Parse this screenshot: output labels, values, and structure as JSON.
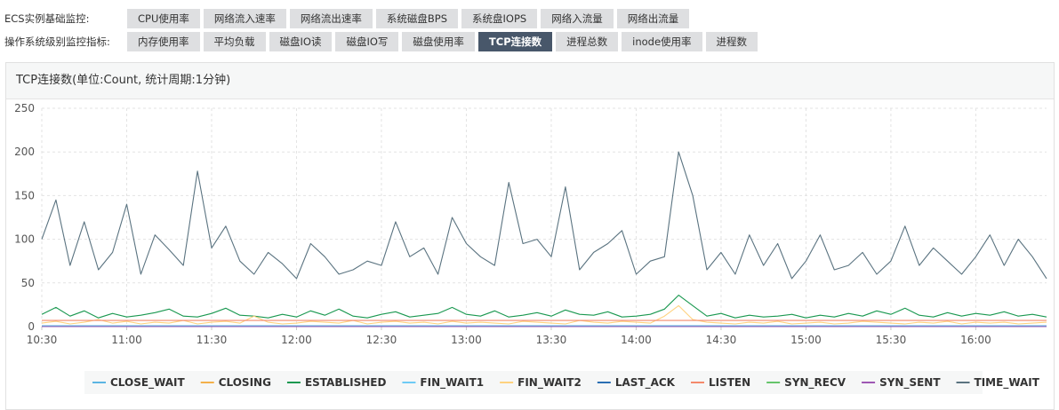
{
  "nav": {
    "ecs_label": "ECS实例基础监控:",
    "ecs_tabs": [
      "CPU使用率",
      "网络流入速率",
      "网络流出速率",
      "系统磁盘BPS",
      "系统盘IOPS",
      "网络入流量",
      "网络出流量"
    ],
    "os_label": "操作系统级别监控指标:",
    "os_tabs": [
      "内存使用率",
      "平均负载",
      "磁盘IO读",
      "磁盘IO写",
      "磁盘使用率",
      "TCP连接数",
      "进程总数",
      "inode使用率",
      "进程数"
    ],
    "active_tab": "TCP连接数"
  },
  "panel": {
    "title": "TCP连接数(单位:Count, 统计周期:1分钟)"
  },
  "chart_data": {
    "type": "line",
    "title": "TCP连接数(单位:Count, 统计周期:1分钟)",
    "x_ticks": [
      "10:30",
      "11:00",
      "11:30",
      "12:00",
      "12:30",
      "13:00",
      "13:30",
      "14:00",
      "14:30",
      "15:00",
      "15:30",
      "16:00"
    ],
    "x_range": [
      "10:30",
      "16:25"
    ],
    "y_ticks": [
      0,
      50,
      100,
      150,
      200,
      250
    ],
    "ylim": [
      0,
      250
    ],
    "grid": true,
    "legend_position": "bottom",
    "sample_interval": "5 minutes",
    "series": [
      {
        "name": "CLOSE_WAIT",
        "color": "#5bb5e3",
        "values": [
          1,
          1,
          1,
          1,
          1,
          1,
          1,
          1,
          1,
          1,
          1,
          1,
          1,
          1,
          1,
          1,
          1,
          1,
          1,
          1,
          1,
          1,
          1,
          1,
          1,
          1,
          1,
          1,
          1,
          1,
          1,
          1,
          1,
          1,
          1,
          1,
          1,
          1,
          1,
          1,
          1,
          1,
          1,
          1,
          1,
          1,
          1,
          1,
          1,
          1,
          1,
          1,
          1,
          1,
          1,
          1,
          1,
          1,
          1,
          1,
          1,
          1,
          1,
          1,
          1,
          1,
          1,
          1,
          1,
          1,
          1,
          1
        ]
      },
      {
        "name": "CLOSING",
        "color": "#f3b04a",
        "values": [
          0,
          0,
          0,
          0,
          0,
          0,
          0,
          0,
          0,
          0,
          0,
          0,
          0,
          0,
          0,
          0,
          0,
          0,
          0,
          0,
          0,
          0,
          0,
          0,
          0,
          0,
          0,
          0,
          0,
          0,
          0,
          0,
          0,
          0,
          0,
          0,
          0,
          0,
          0,
          0,
          0,
          0,
          0,
          0,
          0,
          0,
          0,
          0,
          0,
          0,
          0,
          0,
          0,
          0,
          0,
          0,
          0,
          0,
          0,
          0,
          0,
          0,
          0,
          0,
          0,
          0,
          0,
          0,
          0,
          0,
          0,
          0
        ]
      },
      {
        "name": "ESTABLISHED",
        "color": "#1a9850",
        "values": [
          14,
          22,
          12,
          18,
          10,
          15,
          11,
          13,
          16,
          20,
          12,
          11,
          15,
          21,
          13,
          12,
          10,
          14,
          11,
          18,
          13,
          20,
          12,
          10,
          14,
          17,
          11,
          13,
          15,
          22,
          14,
          12,
          18,
          11,
          13,
          16,
          12,
          19,
          14,
          13,
          17,
          11,
          12,
          14,
          20,
          36,
          24,
          12,
          15,
          10,
          13,
          11,
          12,
          14,
          10,
          13,
          11,
          15,
          12,
          18,
          14,
          21,
          13,
          11,
          16,
          12,
          15,
          13,
          17,
          12,
          14,
          11
        ]
      },
      {
        "name": "FIN_WAIT1",
        "color": "#6ecbf5",
        "values": [
          0,
          0,
          0,
          0,
          0,
          0,
          0,
          0,
          0,
          0,
          0,
          0,
          0,
          0,
          0,
          0,
          0,
          0,
          0,
          0,
          0,
          0,
          0,
          0,
          0,
          0,
          0,
          0,
          0,
          0,
          0,
          0,
          0,
          0,
          0,
          0,
          0,
          0,
          0,
          0,
          0,
          0,
          0,
          0,
          0,
          0,
          0,
          0,
          0,
          0,
          0,
          0,
          0,
          0,
          0,
          0,
          0,
          0,
          0,
          0,
          0,
          0,
          0,
          0,
          0,
          0,
          0,
          0,
          0,
          0,
          0,
          0
        ]
      },
      {
        "name": "FIN_WAIT2",
        "color": "#ffd27f",
        "values": [
          4,
          6,
          3,
          5,
          8,
          4,
          6,
          3,
          5,
          4,
          7,
          3,
          5,
          6,
          4,
          12,
          5,
          3,
          4,
          6,
          5,
          4,
          7,
          3,
          5,
          6,
          4,
          5,
          3,
          6,
          4,
          5,
          4,
          3,
          6,
          5,
          4,
          3,
          7,
          5,
          4,
          6,
          5,
          4,
          12,
          24,
          8,
          5,
          4,
          3,
          5,
          4,
          6,
          3,
          4,
          5,
          3,
          4,
          6,
          5,
          4,
          3,
          5,
          4,
          6,
          3,
          5,
          4,
          5,
          3,
          4,
          5
        ]
      },
      {
        "name": "LAST_ACK",
        "color": "#2b6fb3",
        "values": [
          0,
          0,
          0,
          0,
          0,
          0,
          0,
          0,
          0,
          0,
          0,
          0,
          0,
          0,
          0,
          0,
          0,
          0,
          0,
          0,
          0,
          0,
          0,
          0,
          0,
          0,
          0,
          0,
          0,
          0,
          0,
          0,
          0,
          0,
          0,
          0,
          0,
          0,
          0,
          0,
          0,
          0,
          0,
          0,
          0,
          0,
          0,
          0,
          0,
          0,
          0,
          0,
          0,
          0,
          0,
          0,
          0,
          0,
          0,
          0,
          0,
          0,
          0,
          0,
          0,
          0,
          0,
          0,
          0,
          0,
          0,
          0
        ]
      },
      {
        "name": "LISTEN",
        "color": "#f4896b",
        "values": [
          7,
          7,
          7,
          7,
          7,
          7,
          7,
          7,
          7,
          7,
          7,
          7,
          7,
          7,
          7,
          7,
          7,
          7,
          7,
          7,
          7,
          7,
          7,
          7,
          7,
          7,
          7,
          7,
          7,
          7,
          7,
          7,
          7,
          7,
          7,
          7,
          7,
          7,
          7,
          7,
          7,
          7,
          7,
          7,
          7,
          7,
          7,
          7,
          7,
          7,
          7,
          7,
          7,
          7,
          7,
          7,
          7,
          7,
          7,
          7,
          7,
          7,
          7,
          7,
          7,
          7,
          7,
          7,
          7,
          7,
          7,
          7
        ]
      },
      {
        "name": "SYN_RECV",
        "color": "#66c56b",
        "values": [
          0,
          0,
          0,
          0,
          0,
          0,
          0,
          0,
          0,
          0,
          0,
          0,
          0,
          0,
          0,
          0,
          0,
          0,
          0,
          0,
          0,
          0,
          0,
          0,
          0,
          0,
          0,
          0,
          0,
          0,
          0,
          0,
          0,
          0,
          0,
          0,
          0,
          0,
          0,
          0,
          0,
          0,
          0,
          0,
          0,
          0,
          0,
          0,
          0,
          0,
          0,
          0,
          0,
          0,
          0,
          0,
          0,
          0,
          0,
          0,
          0,
          0,
          0,
          0,
          0,
          0,
          0,
          0,
          0,
          0,
          0,
          0
        ]
      },
      {
        "name": "SYN_SENT",
        "color": "#9e58b4",
        "values": [
          0,
          0,
          0,
          0,
          0,
          0,
          0,
          0,
          0,
          0,
          0,
          0,
          0,
          0,
          0,
          0,
          0,
          0,
          0,
          0,
          0,
          0,
          0,
          0,
          0,
          0,
          0,
          0,
          0,
          0,
          0,
          0,
          0,
          0,
          0,
          0,
          0,
          0,
          0,
          0,
          0,
          0,
          0,
          0,
          0,
          0,
          0,
          0,
          0,
          0,
          0,
          0,
          0,
          0,
          0,
          0,
          0,
          0,
          0,
          0,
          0,
          0,
          0,
          0,
          0,
          0,
          0,
          0,
          0,
          0,
          0,
          0
        ]
      },
      {
        "name": "TIME_WAIT",
        "color": "#5a7380",
        "values": [
          100,
          145,
          70,
          120,
          65,
          85,
          140,
          60,
          105,
          88,
          70,
          178,
          90,
          115,
          75,
          60,
          85,
          72,
          55,
          95,
          80,
          60,
          65,
          75,
          70,
          120,
          80,
          90,
          60,
          125,
          95,
          80,
          70,
          165,
          95,
          100,
          80,
          160,
          65,
          85,
          95,
          110,
          60,
          75,
          80,
          200,
          150,
          65,
          85,
          60,
          105,
          70,
          95,
          55,
          75,
          105,
          65,
          70,
          85,
          60,
          75,
          115,
          70,
          90,
          75,
          60,
          80,
          105,
          70,
          100,
          80,
          55
        ]
      }
    ]
  }
}
